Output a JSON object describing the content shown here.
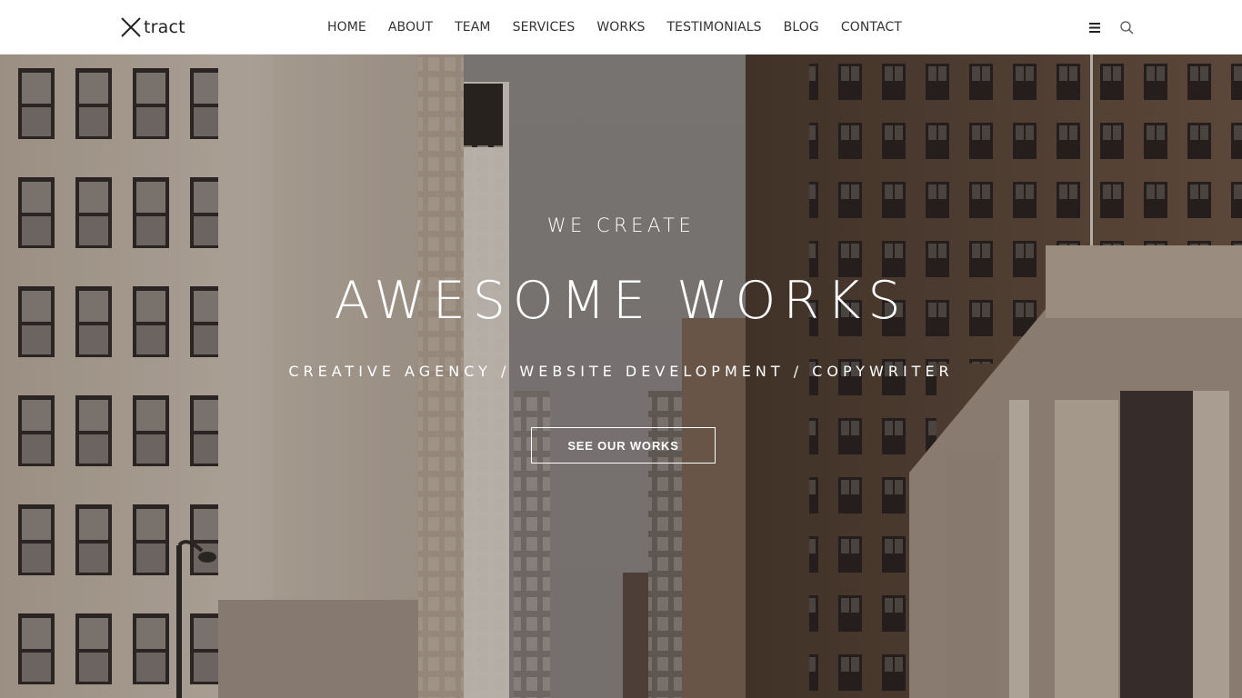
{
  "brand": {
    "logo_text": "tract",
    "logo_mark_icon": "x-logo-icon"
  },
  "nav": {
    "items": [
      {
        "label": "HOME"
      },
      {
        "label": "ABOUT"
      },
      {
        "label": "TEAM"
      },
      {
        "label": "SERVICES"
      },
      {
        "label": "WORKS"
      },
      {
        "label": "TESTIMONIALS"
      },
      {
        "label": "BLOG"
      },
      {
        "label": "CONTACT"
      }
    ],
    "icons": [
      "menu-icon",
      "search-icon"
    ]
  },
  "hero": {
    "pre_title": "WE CREATE",
    "title": "AWESOME WORKS",
    "subtitle": "CREATIVE AGENCY / WEBSITE DEVELOPMENT / COPYWRITER",
    "cta_label": "SEE OUR WORKS",
    "background": "city-street-buildings-photo"
  },
  "colors": {
    "nav_bg": "#ffffff",
    "nav_text": "#333333",
    "hero_text": "#ffffff",
    "sky": "#8a8684"
  }
}
